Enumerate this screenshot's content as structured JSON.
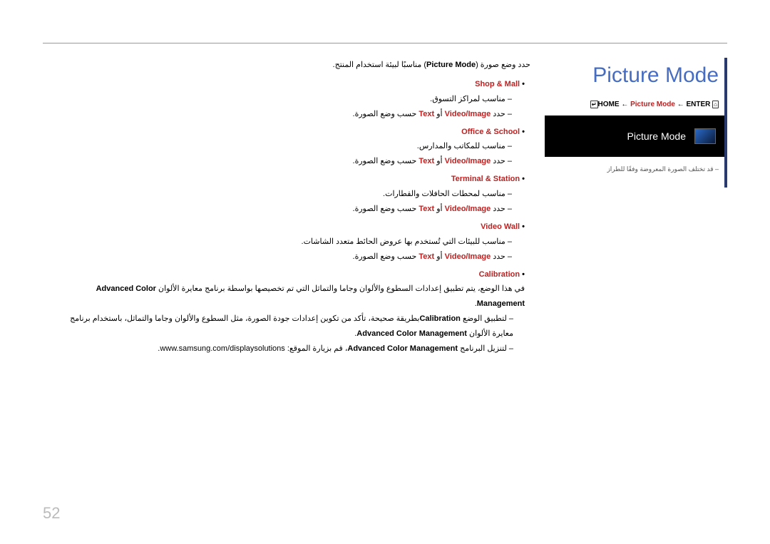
{
  "page_number": "52",
  "title": "Picture Mode",
  "breadcrumb": {
    "home_icon": "⌂",
    "home": "HOME",
    "arrow": "←",
    "mid": "Picture Mode",
    "enter": "ENTER",
    "enter_icon": "↵"
  },
  "osd": {
    "heading": "Picture Mode",
    "note": "– قد تختلف الصورة المعروضة وفقًا للطراز"
  },
  "intro": {
    "text_pre": "حدد وضع صورة (",
    "label": "Picture Mode",
    "text_post": ") مناسبًا لبيئة استخدام المنتج."
  },
  "modes": [
    {
      "name": "Shop & Mall",
      "desc": "مناسب لمراكز التسوق.",
      "select_pre": "– حدد ",
      "vi": "Video/Image",
      "or": " أو ",
      "txt": "Text",
      "select_post": " حسب وضع الصورة."
    },
    {
      "name": "Office & School",
      "desc": "مناسب للمكاتب والمدارس.",
      "select_pre": "– حدد ",
      "vi": "Video/Image",
      "or": " أو ",
      "txt": "Text",
      "select_post": " حسب وضع الصورة."
    },
    {
      "name": "Terminal & Station",
      "desc": "مناسب لمحطات الحافلات والقطارات.",
      "select_pre": "– حدد ",
      "vi": "Video/Image",
      "or": " أو ",
      "txt": "Text",
      "select_post": " حسب وضع الصورة."
    },
    {
      "name": "Video Wall",
      "desc": "مناسب للبيئات التي تُستخدم بها عروض الحائط متعدد الشاشات.",
      "select_pre": "– حدد ",
      "vi": "Video/Image",
      "or": " أو ",
      "txt": "Text",
      "select_post": " حسب وضع الصورة."
    }
  ],
  "calibration": {
    "name": "Calibration",
    "para_pre": "في هذا الوضع، يتم تطبيق إعدادات السطوع والألوان وجاما والتماثل التي تم تخصيصها بواسطة برنامج معايرة الألوان ",
    "acm1": "Advanced Color Management",
    "para_post": ".",
    "b1_pre": "لتطبيق الوضع ",
    "b1_cal": "Calibration",
    "b1_mid": "بطريقة صحيحة، تأكد من تكوين إعدادات جودة الصورة، مثل السطوع والألوان وجاما والتماثل، باستخدام برنامج معايرة الألوان ",
    "b1_acm": "Advanced Color Management",
    "b1_post": ".",
    "b2_pre": "لتنزيل البرنامج ",
    "b2_acm": "Advanced Color Management",
    "b2_mid": "، قم بزيارة الموقع: ",
    "url": "www.samsung.com/displaysolutions",
    "b2_post": "."
  }
}
